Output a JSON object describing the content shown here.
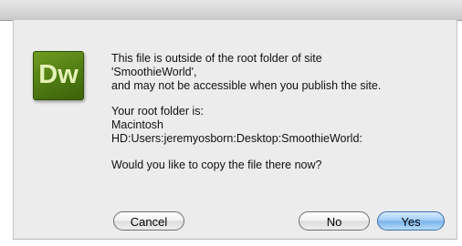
{
  "dialog": {
    "icon": {
      "name": "dreamweaver-app-icon",
      "letters": "Dw",
      "color": "#4f7a12"
    },
    "message": {
      "line1": "This file is outside of the root folder of site",
      "line2": "'SmoothieWorld',",
      "line3": "and may not be accessible when you publish the site.",
      "line4": "Your root folder is:",
      "line5": "Macintosh",
      "line6": "HD:Users:jeremyosborn:Desktop:SmoothieWorld:",
      "line7": "Would you like to copy the file there now?"
    },
    "buttons": {
      "cancel_label": "Cancel",
      "no_label": "No",
      "yes_label": "Yes",
      "default_color": "#7ab3ea"
    }
  }
}
